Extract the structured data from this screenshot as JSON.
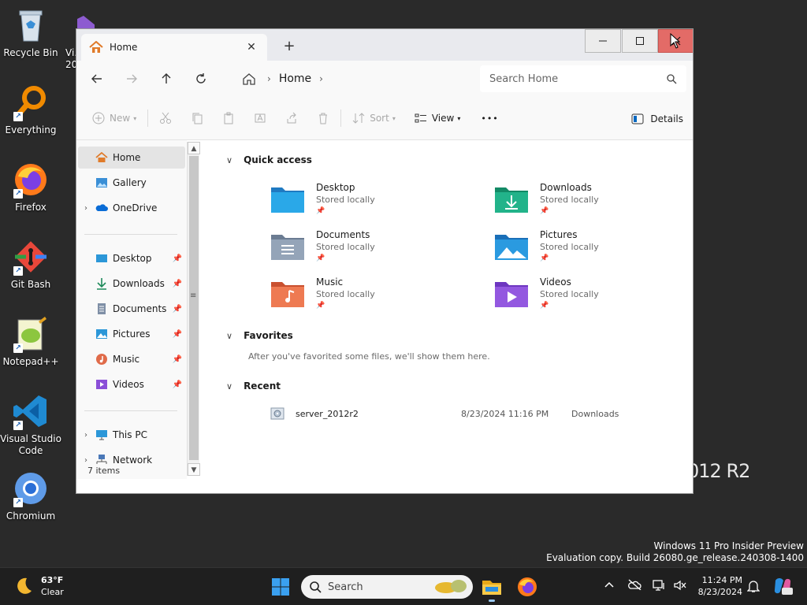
{
  "desktop": {
    "icons": [
      {
        "label": "Recycle Bin"
      },
      {
        "label": "Vi… 20…"
      },
      {
        "label": "Everything"
      },
      {
        "label": "Firefox"
      },
      {
        "label": "Git Bash"
      },
      {
        "label": "Notepad++"
      },
      {
        "label": "Visual Studio Code"
      },
      {
        "label": "Chromium"
      }
    ],
    "watermark_partial": "012 R2",
    "evaluation_line1": "Windows 11 Pro Insider Preview",
    "evaluation_line2": "Evaluation copy. Build 26080.ge_release.240308-1400"
  },
  "window": {
    "tab_title": "Home",
    "tab_close": "✕",
    "new_tab": "+",
    "address": {
      "crumb": "Home"
    },
    "search": {
      "placeholder": "Search Home"
    },
    "commands": {
      "new": "New",
      "sort": "Sort",
      "view": "View",
      "more": "•••",
      "details": "Details"
    },
    "sidebar": {
      "items": [
        {
          "label": "Home"
        },
        {
          "label": "Gallery"
        },
        {
          "label": "OneDrive"
        },
        {
          "label": "Desktop"
        },
        {
          "label": "Downloads"
        },
        {
          "label": "Documents"
        },
        {
          "label": "Pictures"
        },
        {
          "label": "Music"
        },
        {
          "label": "Videos"
        },
        {
          "label": "This PC"
        },
        {
          "label": "Network"
        }
      ]
    },
    "status": "7 items",
    "sections": {
      "quick_access": "Quick access",
      "favorites": "Favorites",
      "recent": "Recent"
    },
    "quick_access": [
      {
        "name": "Desktop",
        "sub": "Stored locally"
      },
      {
        "name": "Downloads",
        "sub": "Stored locally"
      },
      {
        "name": "Documents",
        "sub": "Stored locally"
      },
      {
        "name": "Pictures",
        "sub": "Stored locally"
      },
      {
        "name": "Music",
        "sub": "Stored locally"
      },
      {
        "name": "Videos",
        "sub": "Stored locally"
      }
    ],
    "favorites_empty": "After you've favorited some files, we'll show them here.",
    "recent": [
      {
        "name": "server_2012r2",
        "date": "8/23/2024 11:16 PM",
        "location": "Downloads"
      }
    ]
  },
  "taskbar": {
    "weather_temp": "63°F",
    "weather_desc": "Clear",
    "search_placeholder": "Search",
    "time": "11:24 PM",
    "date": "8/23/2024"
  },
  "colors": {
    "close_button": "#e36b67",
    "accent": "#0067c0"
  }
}
